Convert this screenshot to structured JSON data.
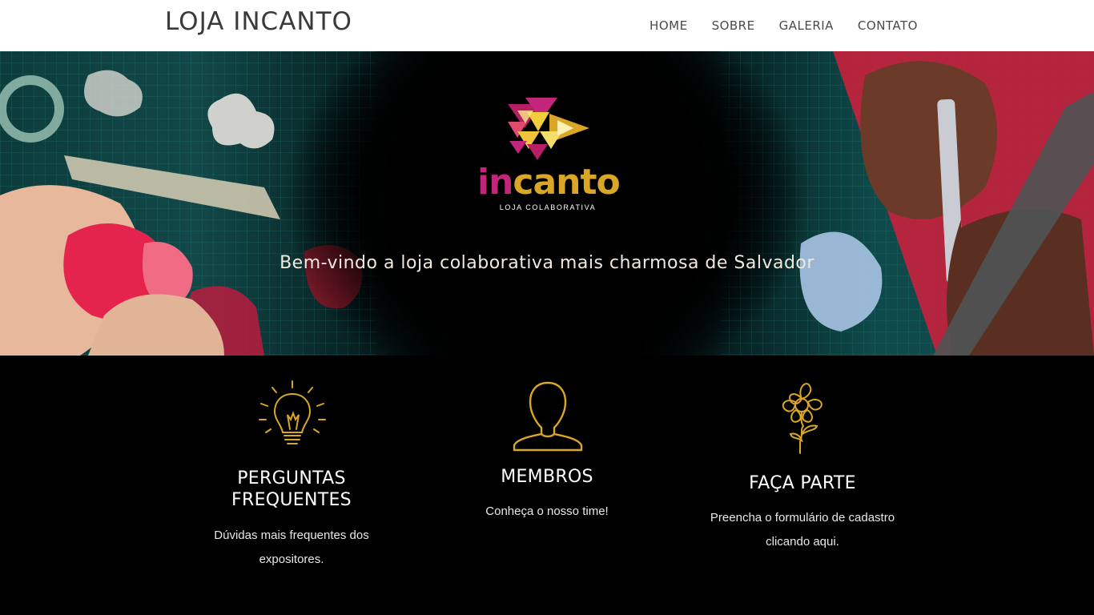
{
  "header": {
    "brand": "LOJA INCANTO",
    "nav": [
      "HOME",
      "SOBRE",
      "GALERIA",
      "CONTATO"
    ]
  },
  "hero": {
    "logo": {
      "word_a": "in",
      "word_b": "canto",
      "subtitle": "LOJA COLABORATIVA"
    },
    "tagline": "Bem-vindo a loja colaborativa mais charmosa de Salvador"
  },
  "features": [
    {
      "icon": "lightbulb-icon",
      "title_line1": "PERGUNTAS",
      "title_line2": "FREQUENTES",
      "text_line1": "Dúvidas mais frequentes dos",
      "text_line2": "expositores."
    },
    {
      "icon": "person-icon",
      "title_line1": "MEMBROS",
      "text_line1": "Conheça o nosso time!"
    },
    {
      "icon": "flower-icon",
      "title_line1": "FAÇA PARTE",
      "text_line1": "Preencha o formulário de cadastro",
      "text_line2": "clicando aqui."
    }
  ],
  "colors": {
    "accent_gold": "#d9a627",
    "accent_magenta": "#c1267a",
    "header_bg": "#ffffff",
    "body_bg": "#000000"
  }
}
